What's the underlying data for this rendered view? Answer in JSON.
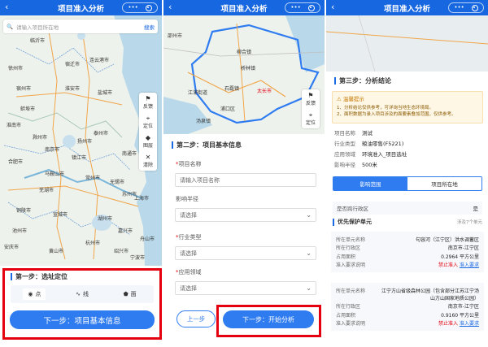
{
  "nav": {
    "title": "项目准入分析",
    "back": "‹",
    "dots": "•••"
  },
  "screen1": {
    "search": {
      "placeholder": "请输入项目所在地",
      "button": "搜索"
    },
    "tools": [
      {
        "icon": "flag-icon",
        "label": "反馈"
      },
      {
        "icon": "locate-icon",
        "label": "定位"
      },
      {
        "icon": "layers-icon",
        "label": "图层"
      },
      {
        "icon": "trash-icon",
        "label": "清除"
      }
    ],
    "map_labels": [
      "临沂市",
      "宿迁市",
      "盐城市",
      "连云港市",
      "淮安市",
      "徐州市",
      "泰州市",
      "南京市",
      "南通市",
      "扬州市",
      "镇江市",
      "常州市",
      "无锡市",
      "苏州市",
      "上海市",
      "湖州市",
      "嘉兴市",
      "杭州市",
      "绍兴市",
      "宁波市",
      "马鞍山市",
      "芜湖市",
      "宣城市",
      "铜陵市",
      "池州市",
      "黄山市",
      "安庆市",
      "合肥市",
      "滁州市",
      "淮南市",
      "蚌埠市",
      "宿州市",
      "舟山市"
    ],
    "step_title": "第一步：选址定位",
    "modes": [
      {
        "icon": "point-icon",
        "label": "点"
      },
      {
        "icon": "line-icon",
        "label": "线"
      },
      {
        "icon": "polygon-icon",
        "label": "面"
      }
    ],
    "next_button": "下一步：项目基本信息"
  },
  "screen2": {
    "map_labels": [
      "柳合镇",
      "桥林镇",
      "石磊镇",
      "江浦街道",
      "太长市",
      "邵州市",
      "浦口区",
      "汤泉镇"
    ],
    "tools": [
      {
        "icon": "flag-icon",
        "label": "反馈"
      },
      {
        "icon": "locate-icon",
        "label": "定位"
      }
    ],
    "step_title": "第二步：项目基本信息",
    "fields": [
      {
        "label": "项目名称",
        "required": true,
        "value": "请输入项目名称",
        "select": false
      },
      {
        "label": "影响半径",
        "required": false,
        "value": "请选择",
        "select": true
      },
      {
        "label": "行业类型",
        "required": true,
        "value": "请选择",
        "select": true
      },
      {
        "label": "应用领域",
        "required": true,
        "value": "请选择",
        "select": true
      }
    ],
    "prev_button": "上一步",
    "next_button": "下一步：开始分析"
  },
  "screen3": {
    "step_title": "第三步：分析结论",
    "warning": {
      "title": "温馨提示",
      "lines": [
        "1、分析结论仅供参考，可详询当地生态环境局。",
        "2、面积数据为录入项目涉及的面要素叠加范围，仅供参考。"
      ]
    },
    "kv": [
      {
        "k": "项目名称",
        "v": "测试"
      },
      {
        "k": "行业类型",
        "v": "粮油零售(F5221)"
      },
      {
        "k": "应用领域",
        "v": "环境准入_项目选址"
      },
      {
        "k": "影响半径",
        "v": "500米"
      }
    ],
    "tabs": [
      "影响范围",
      "项目所在地"
    ],
    "cross_region": {
      "k": "是否跨行政区",
      "v": "是"
    },
    "priority": {
      "title": "优先保护单元",
      "count": "涉及7个单元"
    },
    "cards": [
      {
        "rows": [
          {
            "k": "所在单元名称",
            "v": "句容河（江宁区）洪水调蓄区"
          },
          {
            "k": "所在行政区",
            "v": "南京市-江宁区"
          },
          {
            "k": "占用面积",
            "v": "0.2964 平方公里"
          },
          {
            "k": "准入要求说明",
            "v": "禁止准入",
            "link": "准入要求"
          }
        ]
      },
      {
        "rows": [
          {
            "k": "所在单元名称",
            "v": "江宁方山省级森林公园（包含部分江苏江宁汤山方山国家地质公园）"
          },
          {
            "k": "所在行政区",
            "v": "南京市-江宁区"
          },
          {
            "k": "占用面积",
            "v": "0.9160 平方公里"
          },
          {
            "k": "准入要求说明",
            "v": "禁止准入",
            "link": "准入要求"
          }
        ]
      }
    ]
  }
}
